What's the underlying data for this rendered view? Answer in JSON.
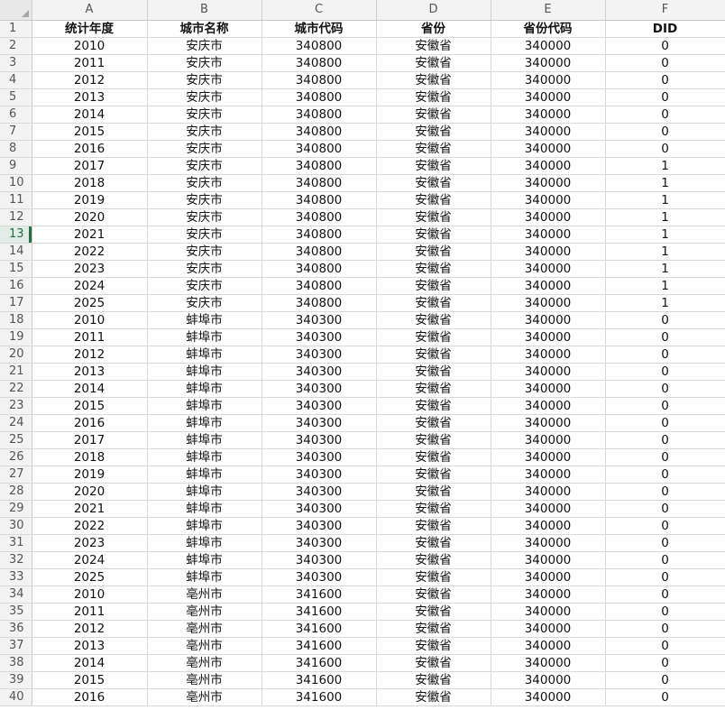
{
  "columns": [
    "A",
    "B",
    "C",
    "D",
    "E",
    "F"
  ],
  "header_row": [
    "统计年度",
    "城市名称",
    "城市代码",
    "省份",
    "省份代码",
    "DID"
  ],
  "selected_row": "13",
  "accent_color": "#1e7145",
  "rows": [
    [
      "2",
      "2010",
      "安庆市",
      "340800",
      "安徽省",
      "340000",
      "0"
    ],
    [
      "3",
      "2011",
      "安庆市",
      "340800",
      "安徽省",
      "340000",
      "0"
    ],
    [
      "4",
      "2012",
      "安庆市",
      "340800",
      "安徽省",
      "340000",
      "0"
    ],
    [
      "5",
      "2013",
      "安庆市",
      "340800",
      "安徽省",
      "340000",
      "0"
    ],
    [
      "6",
      "2014",
      "安庆市",
      "340800",
      "安徽省",
      "340000",
      "0"
    ],
    [
      "7",
      "2015",
      "安庆市",
      "340800",
      "安徽省",
      "340000",
      "0"
    ],
    [
      "8",
      "2016",
      "安庆市",
      "340800",
      "安徽省",
      "340000",
      "0"
    ],
    [
      "9",
      "2017",
      "安庆市",
      "340800",
      "安徽省",
      "340000",
      "1"
    ],
    [
      "10",
      "2018",
      "安庆市",
      "340800",
      "安徽省",
      "340000",
      "1"
    ],
    [
      "11",
      "2019",
      "安庆市",
      "340800",
      "安徽省",
      "340000",
      "1"
    ],
    [
      "12",
      "2020",
      "安庆市",
      "340800",
      "安徽省",
      "340000",
      "1"
    ],
    [
      "13",
      "2021",
      "安庆市",
      "340800",
      "安徽省",
      "340000",
      "1"
    ],
    [
      "14",
      "2022",
      "安庆市",
      "340800",
      "安徽省",
      "340000",
      "1"
    ],
    [
      "15",
      "2023",
      "安庆市",
      "340800",
      "安徽省",
      "340000",
      "1"
    ],
    [
      "16",
      "2024",
      "安庆市",
      "340800",
      "安徽省",
      "340000",
      "1"
    ],
    [
      "17",
      "2025",
      "安庆市",
      "340800",
      "安徽省",
      "340000",
      "1"
    ],
    [
      "18",
      "2010",
      "蚌埠市",
      "340300",
      "安徽省",
      "340000",
      "0"
    ],
    [
      "19",
      "2011",
      "蚌埠市",
      "340300",
      "安徽省",
      "340000",
      "0"
    ],
    [
      "20",
      "2012",
      "蚌埠市",
      "340300",
      "安徽省",
      "340000",
      "0"
    ],
    [
      "21",
      "2013",
      "蚌埠市",
      "340300",
      "安徽省",
      "340000",
      "0"
    ],
    [
      "22",
      "2014",
      "蚌埠市",
      "340300",
      "安徽省",
      "340000",
      "0"
    ],
    [
      "23",
      "2015",
      "蚌埠市",
      "340300",
      "安徽省",
      "340000",
      "0"
    ],
    [
      "24",
      "2016",
      "蚌埠市",
      "340300",
      "安徽省",
      "340000",
      "0"
    ],
    [
      "25",
      "2017",
      "蚌埠市",
      "340300",
      "安徽省",
      "340000",
      "0"
    ],
    [
      "26",
      "2018",
      "蚌埠市",
      "340300",
      "安徽省",
      "340000",
      "0"
    ],
    [
      "27",
      "2019",
      "蚌埠市",
      "340300",
      "安徽省",
      "340000",
      "0"
    ],
    [
      "28",
      "2020",
      "蚌埠市",
      "340300",
      "安徽省",
      "340000",
      "0"
    ],
    [
      "29",
      "2021",
      "蚌埠市",
      "340300",
      "安徽省",
      "340000",
      "0"
    ],
    [
      "30",
      "2022",
      "蚌埠市",
      "340300",
      "安徽省",
      "340000",
      "0"
    ],
    [
      "31",
      "2023",
      "蚌埠市",
      "340300",
      "安徽省",
      "340000",
      "0"
    ],
    [
      "32",
      "2024",
      "蚌埠市",
      "340300",
      "安徽省",
      "340000",
      "0"
    ],
    [
      "33",
      "2025",
      "蚌埠市",
      "340300",
      "安徽省",
      "340000",
      "0"
    ],
    [
      "34",
      "2010",
      "亳州市",
      "341600",
      "安徽省",
      "340000",
      "0"
    ],
    [
      "35",
      "2011",
      "亳州市",
      "341600",
      "安徽省",
      "340000",
      "0"
    ],
    [
      "36",
      "2012",
      "亳州市",
      "341600",
      "安徽省",
      "340000",
      "0"
    ],
    [
      "37",
      "2013",
      "亳州市",
      "341600",
      "安徽省",
      "340000",
      "0"
    ],
    [
      "38",
      "2014",
      "亳州市",
      "341600",
      "安徽省",
      "340000",
      "0"
    ],
    [
      "39",
      "2015",
      "亳州市",
      "341600",
      "安徽省",
      "340000",
      "0"
    ],
    [
      "40",
      "2016",
      "亳州市",
      "341600",
      "安徽省",
      "340000",
      "0"
    ]
  ]
}
